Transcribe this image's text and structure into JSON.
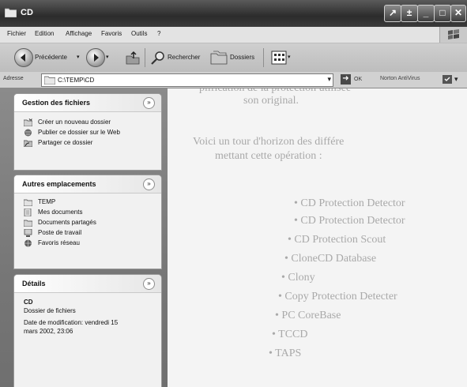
{
  "window": {
    "title": "CD",
    "buttons": [
      "↗",
      "±",
      "_",
      "□",
      "✕"
    ]
  },
  "menu": {
    "items": [
      "Fichier",
      "Edition",
      "Affichage",
      "Favoris",
      "Outils",
      "?"
    ]
  },
  "toolbar": {
    "back_label": "Précédente",
    "search_label": "Rechercher",
    "folders_label": "Dossiers"
  },
  "address": {
    "label": "Adresse",
    "path": "C:\\TEMP\\CD",
    "go_label": "OK",
    "norton_label": "Norton AntiVirus"
  },
  "sidebar": {
    "file_tasks": {
      "title": "Gestion des fichiers",
      "items": [
        {
          "label": "Créer un nouveau dossier",
          "icon": "new-folder-icon"
        },
        {
          "label": "Publier ce dossier sur le Web",
          "icon": "publish-web-icon"
        },
        {
          "label": "Partager ce dossier",
          "icon": "share-folder-icon"
        }
      ]
    },
    "other_places": {
      "title": "Autres emplacements",
      "items": [
        {
          "label": "TEMP",
          "icon": "folder-icon"
        },
        {
          "label": "Mes documents",
          "icon": "my-documents-icon"
        },
        {
          "label": "Documents partagés",
          "icon": "shared-documents-icon"
        },
        {
          "label": "Poste de travail",
          "icon": "computer-icon"
        },
        {
          "label": "Favoris réseau",
          "icon": "network-icon"
        }
      ]
    },
    "details": {
      "title": "Détails",
      "name": "CD",
      "type": "Dossier de fichiers",
      "modified_line1": "Date de modification: vendredi 15",
      "modified_line2": "mars 2002, 23:06"
    }
  },
  "background_text": {
    "lines": [
      "plification de la protection utilisée",
      "son original.",
      "Voici un tour d'horizon des différe",
      "mettant cette opération :",
      "• CD Protection Detector",
      "• CD Protection Detector",
      "• CD Protection Scout",
      "• CloneCD Database",
      "• Clony",
      "• Copy Protection Detecter",
      "• PC CoreBase",
      "• TCCD",
      "• TAPS"
    ]
  }
}
